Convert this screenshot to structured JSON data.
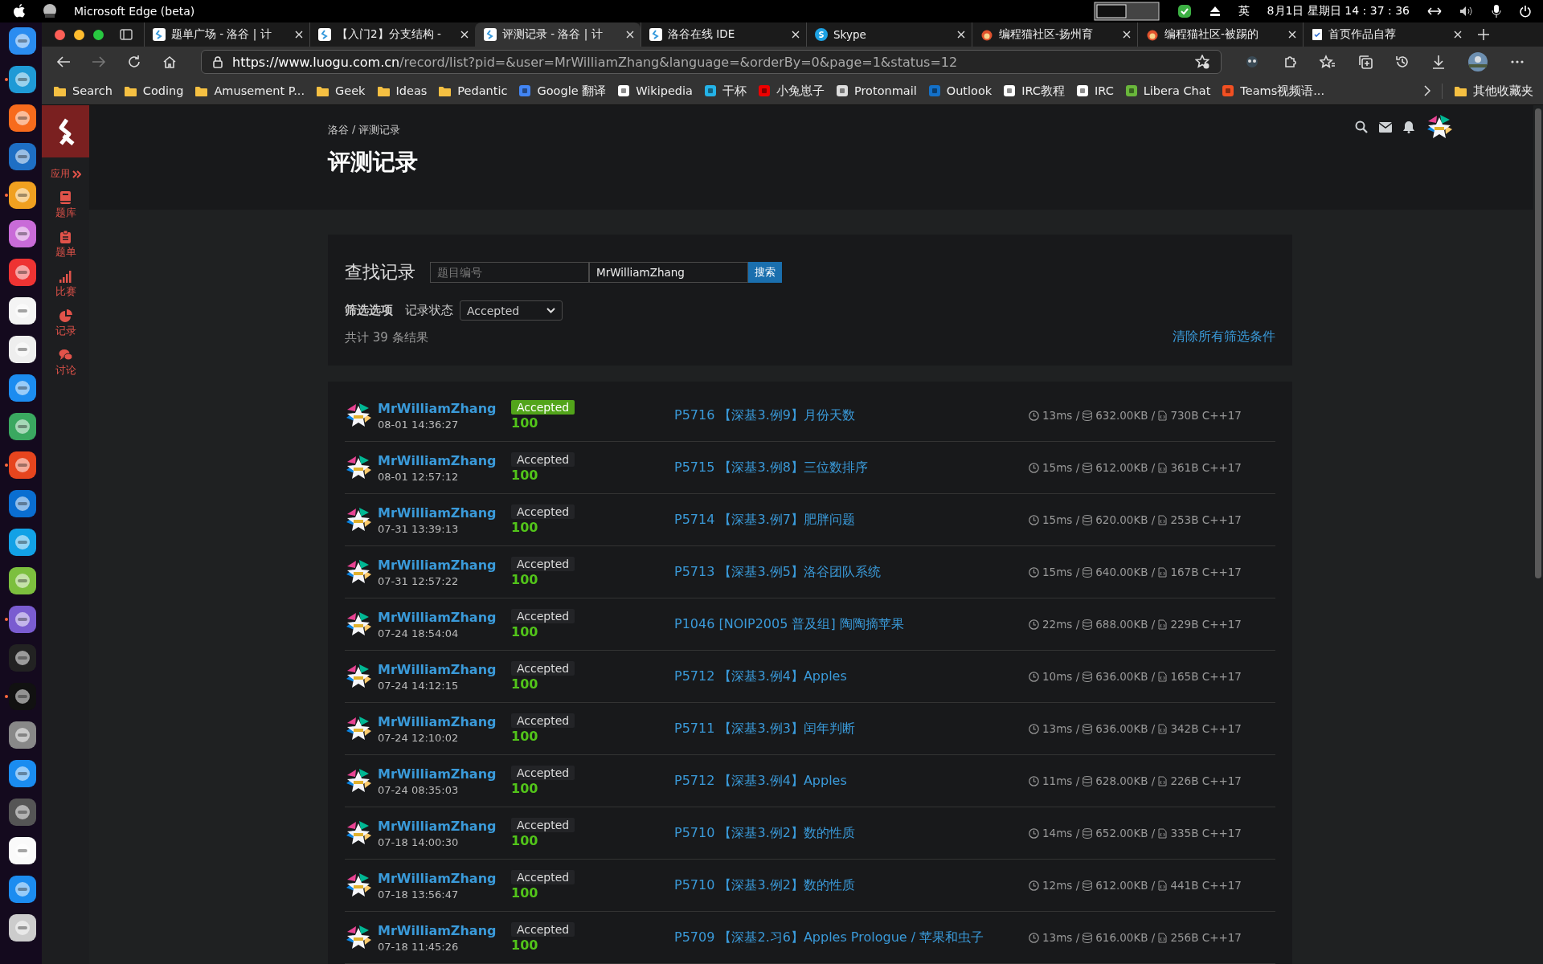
{
  "menu_bar": {
    "app_name": "Microsoft Edge (beta)",
    "input_method": "英",
    "clock": "8月1日 星期日 14 : 37 : 36"
  },
  "dock": [
    {
      "running": false
    },
    {
      "running": true
    },
    {
      "running": false
    },
    {
      "running": false
    },
    {
      "running": true
    },
    {
      "running": false
    },
    {
      "running": false
    },
    {
      "running": false
    },
    {
      "running": false
    },
    {
      "running": false
    },
    {
      "running": false
    },
    {
      "running": true
    },
    {
      "running": false
    },
    {
      "running": false
    },
    {
      "running": false
    },
    {
      "running": true
    },
    {
      "running": false
    },
    {
      "running": true
    },
    {
      "running": false
    },
    {
      "running": false
    },
    {
      "running": false
    },
    {
      "running": false
    },
    {
      "running": false
    },
    {
      "running": false
    }
  ],
  "tabs": [
    {
      "label": "题单广场 - 洛谷 | 计",
      "selected": false
    },
    {
      "label": "【入门2】分支结构 -",
      "selected": false
    },
    {
      "label": "评测记录 - 洛谷 | 计",
      "selected": true
    },
    {
      "label": "洛谷在线 IDE",
      "selected": false
    },
    {
      "label": "Skype",
      "selected": false
    },
    {
      "label": "编程猫社区-扬州育",
      "selected": false
    },
    {
      "label": "编程猫社区-被踢的",
      "selected": false
    },
    {
      "label": "首页作品自荐",
      "selected": false
    }
  ],
  "address_bar": {
    "host": "https://www.luogu.com.cn",
    "path": "/record/list?pid=&user=MrWilliamZhang&language=&orderBy=0&page=1&status=12"
  },
  "bookmarks": [
    {
      "label": "Search",
      "kind": "folder"
    },
    {
      "label": "Coding",
      "kind": "folder"
    },
    {
      "label": "Amusement P...",
      "kind": "folder"
    },
    {
      "label": "Geek",
      "kind": "folder"
    },
    {
      "label": "Ideas",
      "kind": "folder"
    },
    {
      "label": "Pedantic",
      "kind": "folder"
    },
    {
      "label": "Google 翻译",
      "kind": "site"
    },
    {
      "label": "Wikipedia",
      "kind": "site"
    },
    {
      "label": "干杯",
      "kind": "site"
    },
    {
      "label": "小兔崽子",
      "kind": "site"
    },
    {
      "label": "Protonmail",
      "kind": "site"
    },
    {
      "label": "Outlook",
      "kind": "site"
    },
    {
      "label": "IRC教程",
      "kind": "site"
    },
    {
      "label": "IRC",
      "kind": "site"
    },
    {
      "label": "Libera Chat",
      "kind": "site"
    },
    {
      "label": "Teams视频语...",
      "kind": "site"
    }
  ],
  "other_bookmarks": "其他收藏夹",
  "sidebar": {
    "apps_label": "应用",
    "items": [
      {
        "label": "题库"
      },
      {
        "label": "题单"
      },
      {
        "label": "比赛"
      },
      {
        "label": "记录"
      },
      {
        "label": "讨论"
      }
    ]
  },
  "breadcrumb": [
    {
      "label": "洛谷"
    },
    {
      "label": "/"
    },
    {
      "label": "评测记录"
    }
  ],
  "page_title": "评测记录",
  "search": {
    "title": "查找记录",
    "problem_field": {
      "placeholder": "题目编号"
    },
    "user_field": {
      "value": "MrWilliamZhang"
    },
    "button": "搜索"
  },
  "filters": {
    "title": "筛选选项",
    "status_label": "记录状态",
    "status_value": "Accepted",
    "total": "共计 39 条结果",
    "clear": "清除所有筛选条件"
  },
  "records": [
    {
      "user": "MrWilliamZhang",
      "submitted": "08-01 14:36:27",
      "status": "Accepted",
      "highlighted": true,
      "score": "100",
      "problem": "P5716 【深基3.例9】月份天数",
      "time": "13ms /",
      "memory": "632.00KB /",
      "code": "730B C++17"
    },
    {
      "user": "MrWilliamZhang",
      "submitted": "08-01 12:57:12",
      "status": "Accepted",
      "highlighted": false,
      "score": "100",
      "problem": "P5715 【深基3.例8】三位数排序",
      "time": "15ms /",
      "memory": "612.00KB /",
      "code": "361B C++17"
    },
    {
      "user": "MrWilliamZhang",
      "submitted": "07-31 13:39:13",
      "status": "Accepted",
      "highlighted": false,
      "score": "100",
      "problem": "P5714 【深基3.例7】肥胖问题",
      "time": "15ms /",
      "memory": "620.00KB /",
      "code": "253B C++17"
    },
    {
      "user": "MrWilliamZhang",
      "submitted": "07-31 12:57:22",
      "status": "Accepted",
      "highlighted": false,
      "score": "100",
      "problem": "P5713 【深基3.例5】洛谷团队系统",
      "time": "15ms /",
      "memory": "640.00KB /",
      "code": "167B C++17"
    },
    {
      "user": "MrWilliamZhang",
      "submitted": "07-24 18:54:04",
      "status": "Accepted",
      "highlighted": false,
      "score": "100",
      "problem": "P1046 [NOIP2005 普及组] 陶陶摘苹果",
      "time": "22ms /",
      "memory": "688.00KB /",
      "code": "229B C++17"
    },
    {
      "user": "MrWilliamZhang",
      "submitted": "07-24 14:12:15",
      "status": "Accepted",
      "highlighted": false,
      "score": "100",
      "problem": "P5712 【深基3.例4】Apples",
      "time": "10ms /",
      "memory": "636.00KB /",
      "code": "165B C++17"
    },
    {
      "user": "MrWilliamZhang",
      "submitted": "07-24 12:10:02",
      "status": "Accepted",
      "highlighted": false,
      "score": "100",
      "problem": "P5711 【深基3.例3】闰年判断",
      "time": "13ms /",
      "memory": "636.00KB /",
      "code": "342B C++17"
    },
    {
      "user": "MrWilliamZhang",
      "submitted": "07-24 08:35:03",
      "status": "Accepted",
      "highlighted": false,
      "score": "100",
      "problem": "P5712 【深基3.例4】Apples",
      "time": "11ms /",
      "memory": "628.00KB /",
      "code": "226B C++17"
    },
    {
      "user": "MrWilliamZhang",
      "submitted": "07-18 14:00:30",
      "status": "Accepted",
      "highlighted": false,
      "score": "100",
      "problem": "P5710 【深基3.例2】数的性质",
      "time": "14ms /",
      "memory": "652.00KB /",
      "code": "335B C++17"
    },
    {
      "user": "MrWilliamZhang",
      "submitted": "07-18 13:56:47",
      "status": "Accepted",
      "highlighted": false,
      "score": "100",
      "problem": "P5710 【深基3.例2】数的性质",
      "time": "12ms /",
      "memory": "612.00KB /",
      "code": "441B C++17"
    },
    {
      "user": "MrWilliamZhang",
      "submitted": "07-18 11:45:26",
      "status": "Accepted",
      "highlighted": false,
      "score": "100",
      "problem": "P5709 【深基2.习6】Apples Prologue / 苹果和虫子",
      "time": "13ms /",
      "memory": "616.00KB /",
      "code": "256B C++17"
    }
  ]
}
